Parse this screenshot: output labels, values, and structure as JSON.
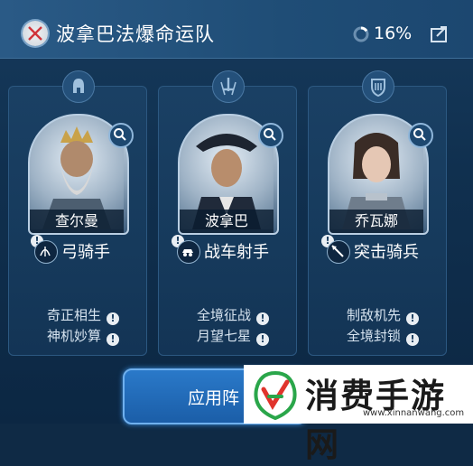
{
  "header": {
    "team_name": "波拿巴法爆命运队",
    "progress_text": "16%",
    "progress_fraction": 0.16
  },
  "cards": [
    {
      "name": "查尔曼",
      "role": "弓骑手",
      "emblem_icon": "helmet-emblem-icon",
      "role_icon": "bow-icon",
      "skills": [
        "奇正相生",
        "神机妙算"
      ]
    },
    {
      "name": "波拿巴",
      "role": "战车射手",
      "emblem_icon": "sword-emblem-icon",
      "role_icon": "chariot-icon",
      "skills": [
        "全境征战",
        "月望七星"
      ]
    },
    {
      "name": "乔瓦娜",
      "role": "突击骑兵",
      "emblem_icon": "shield-emblem-icon",
      "role_icon": "lance-icon",
      "skills": [
        "制敌机先",
        "全境封锁"
      ]
    }
  ],
  "apply_button": {
    "label": "应用阵"
  },
  "watermark": {
    "title": "消费手游网",
    "url": "www.xinnanwang.com"
  },
  "colors": {
    "panel": "#163a5c",
    "header": "#2a5a86",
    "accent": "#2a79c9"
  }
}
